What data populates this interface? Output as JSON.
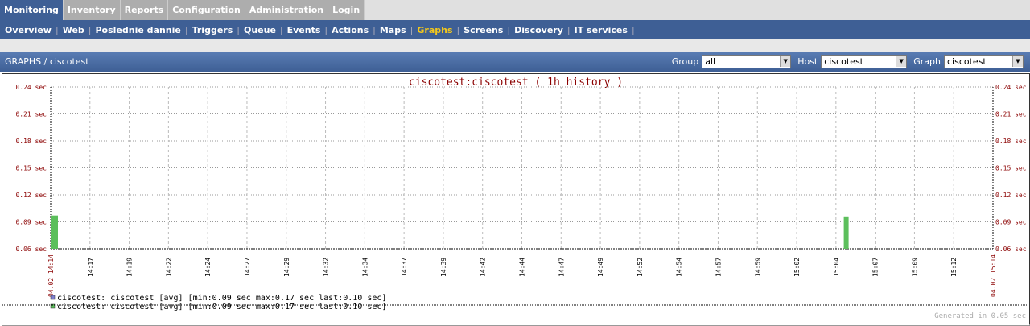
{
  "top_menu": [
    "Monitoring",
    "Inventory",
    "Reports",
    "Configuration",
    "Administration",
    "Login"
  ],
  "sub_menu": [
    "Overview",
    "Web",
    "Poslednie dannie",
    "Triggers",
    "Queue",
    "Events",
    "Actions",
    "Maps",
    "Graphs",
    "Screens",
    "Discovery",
    "IT services"
  ],
  "header": {
    "title": "GRAPHS / ciscotest",
    "group_label": "Group",
    "group_value": "all",
    "host_label": "Host",
    "host_value": "ciscotest",
    "graph_label": "Graph",
    "graph_value": "ciscotest"
  },
  "footer": "Generated in 0.05 sec",
  "colors": {
    "series": "#5cbf5c",
    "axis_text": "#8b0000",
    "accent": "#3e5f95"
  },
  "chart_data": {
    "type": "bar",
    "title": "ciscotest:ciscotest ( 1h history )",
    "yticks": [
      "0.06 sec",
      "0.09 sec",
      "0.12 sec",
      "0.15 sec",
      "0.18 sec",
      "0.21 sec",
      "0.24 sec"
    ],
    "ylim": [
      0.06,
      0.24
    ],
    "start_label": "04.02 14:14",
    "end_label": "04.02 15:14",
    "xticks": [
      "14:17",
      "14:19",
      "14:22",
      "14:24",
      "14:27",
      "14:29",
      "14:32",
      "14:34",
      "14:37",
      "14:39",
      "14:42",
      "14:44",
      "14:47",
      "14:49",
      "14:52",
      "14:54",
      "14:57",
      "14:59",
      "15:02",
      "15:04",
      "15:07",
      "15:09",
      "15:12"
    ],
    "xrange_minutes": [
      0,
      60
    ],
    "series": [
      {
        "name": "ciscotest: ciscotest",
        "points": [
          {
            "minute": 0,
            "value": 0.097
          },
          {
            "minute": 50.5,
            "value": 0.096
          }
        ]
      }
    ],
    "legend": [
      "ciscotest: ciscotest [avg] [min:0.09 sec max:0.17 sec last:0.10 sec]",
      "ciscotest: ciscotest [avg] [min:0.09 sec max:0.17 sec last:0.10 sec]"
    ]
  }
}
